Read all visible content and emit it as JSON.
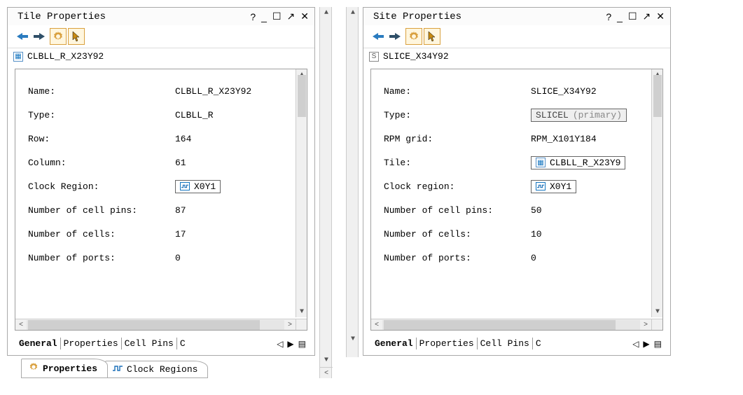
{
  "left": {
    "title": "Tile Properties",
    "path_icon": "tile-icon",
    "path_name": "CLBLL_R_X23Y92",
    "props": [
      {
        "label": "Name:",
        "value": "CLBLL_R_X23Y92",
        "type": "text"
      },
      {
        "label": "Type:",
        "value": "CLBLL_R",
        "type": "text"
      },
      {
        "label": "Row:",
        "value": "164",
        "type": "text"
      },
      {
        "label": "Column:",
        "value": "61",
        "type": "text"
      },
      {
        "label": "Clock Region:",
        "value": "X0Y1",
        "type": "region"
      },
      {
        "label": "Number of cell pins:",
        "value": "87",
        "type": "text"
      },
      {
        "label": "Number of cells:",
        "value": "17",
        "type": "text"
      },
      {
        "label": "Number of ports:",
        "value": "0",
        "type": "text"
      }
    ],
    "inner_tabs": [
      "General",
      "Properties",
      "Cell Pins",
      "C"
    ],
    "bottom_tabs": [
      {
        "label": "Properties",
        "icon": "gear",
        "active": true
      },
      {
        "label": "Clock Regions",
        "icon": "wave",
        "active": false
      }
    ]
  },
  "right": {
    "title": "Site Properties",
    "path_icon": "site-icon",
    "path_name": "SLICE_X34Y92",
    "props": [
      {
        "label": "Name:",
        "value": "SLICE_X34Y92",
        "type": "text"
      },
      {
        "label": "Type:",
        "value": "SLICEL",
        "extra": "(primary)",
        "type": "grey"
      },
      {
        "label": "RPM grid:",
        "value": "RPM_X101Y184",
        "type": "text"
      },
      {
        "label": "Tile:",
        "value": "CLBLL_R_X23Y9",
        "type": "tile"
      },
      {
        "label": "Clock region:",
        "value": "X0Y1",
        "type": "region"
      },
      {
        "label": "Number of cell pins:",
        "value": "50",
        "type": "text"
      },
      {
        "label": "Number of cells:",
        "value": "10",
        "type": "text"
      },
      {
        "label": "Number of ports:",
        "value": "0",
        "type": "text"
      }
    ],
    "inner_tabs": [
      "General",
      "Properties",
      "Cell Pins",
      "C"
    ]
  },
  "titlebar_glyphs": {
    "help": "?",
    "min": "_",
    "max": "☐",
    "pop": "↗",
    "close": "✕"
  },
  "nav_glyphs": {
    "left": "◁",
    "right": "▶",
    "list": "▤"
  }
}
